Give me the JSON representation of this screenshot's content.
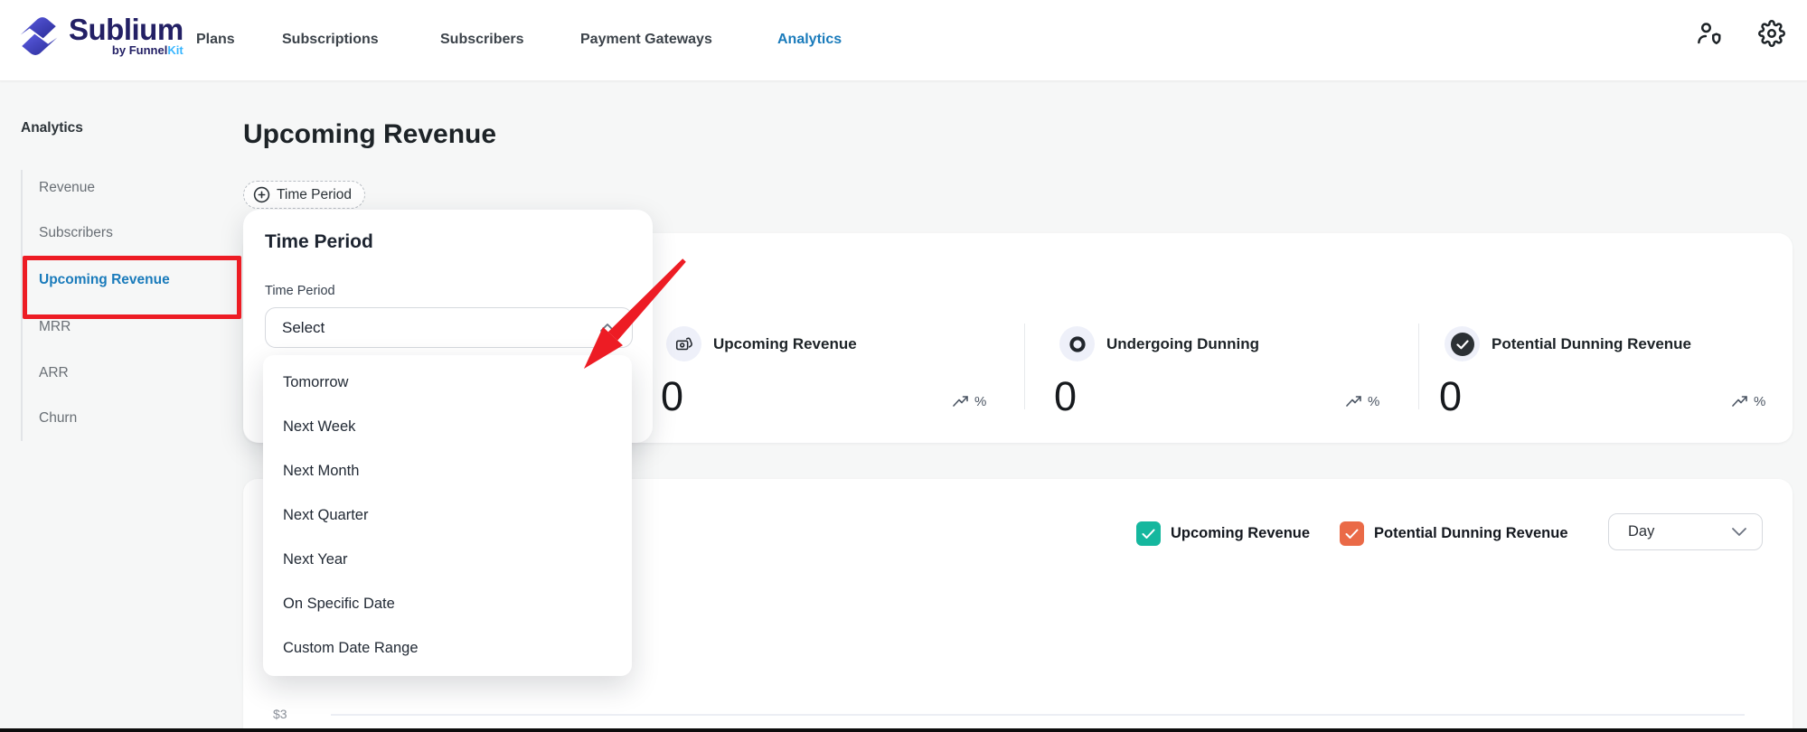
{
  "brand": {
    "name": "Sublium",
    "byline_prefix": "by ",
    "byline_main": "Funnel",
    "byline_accent": "Kit"
  },
  "nav": {
    "items": [
      {
        "label": "Plans",
        "active": false
      },
      {
        "label": "Subscriptions",
        "active": false
      },
      {
        "label": "Subscribers",
        "active": false
      },
      {
        "label": "Payment Gateways",
        "active": false
      },
      {
        "label": "Analytics",
        "active": true
      }
    ]
  },
  "sidebar": {
    "heading": "Analytics",
    "items": [
      {
        "label": "Revenue",
        "active": false
      },
      {
        "label": "Subscribers",
        "active": false
      },
      {
        "label": "Upcoming Revenue",
        "active": true
      },
      {
        "label": "MRR",
        "active": false
      },
      {
        "label": "ARR",
        "active": false
      },
      {
        "label": "Churn",
        "active": false
      }
    ]
  },
  "page": {
    "title": "Upcoming Revenue",
    "filter_chip_label": "Time Period"
  },
  "time_period_panel": {
    "heading": "Time Period",
    "field_label": "Time Period",
    "select_value": "Select",
    "options": [
      "Tomorrow",
      "Next Week",
      "Next Month",
      "Next Quarter",
      "Next Year",
      "On Specific Date",
      "Custom Date Range"
    ]
  },
  "stats": [
    {
      "icon": "cash-hand-icon",
      "label": "Upcoming Revenue",
      "value": "0",
      "trend_unit": "%"
    },
    {
      "icon": "ring-icon",
      "label": "Undergoing Dunning",
      "value": "0",
      "trend_unit": "%"
    },
    {
      "icon": "check-circle-icon",
      "label": "Potential Dunning Revenue",
      "value": "0",
      "trend_unit": "%"
    }
  ],
  "chart": {
    "legend": [
      {
        "label": "Upcoming Revenue",
        "color": "#15b79e",
        "checked": true
      },
      {
        "label": "Potential Dunning Revenue",
        "color": "#ea6a47",
        "checked": true
      }
    ],
    "granularity_value": "Day",
    "visible_y_tick": "$3"
  },
  "colors": {
    "accent_blue": "#1a7bbb",
    "annotation_red": "#ed1c24",
    "legend_teal": "#15b79e",
    "legend_orange": "#ea6a47",
    "brand_navy": "#232065",
    "brand_cyan": "#38b6ff"
  }
}
